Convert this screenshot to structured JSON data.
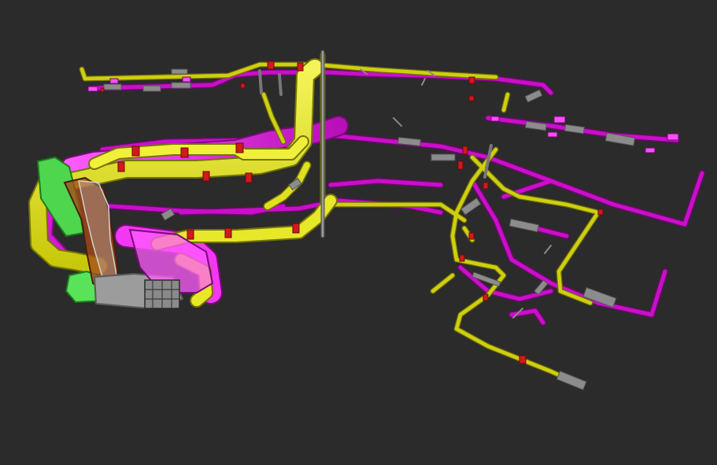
{
  "viewer": {
    "background": "#2b2b2b"
  },
  "colors": {
    "supply_duct": "#e3e30f",
    "supply_duct_dark": "#7a7a05",
    "return_duct": "#c90fc9",
    "return_duct_light": "#ff33ff",
    "exhaust_unit": "#33d633",
    "flex_connector": "#8c8c8c",
    "fitting": "#d11a1a",
    "riser": "#808080",
    "air_handler_frame": "#9a9a9a"
  },
  "legend_visible": false,
  "toolbar_visible": false
}
